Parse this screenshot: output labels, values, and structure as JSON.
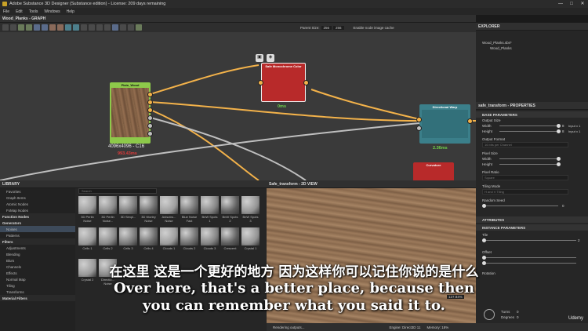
{
  "window": {
    "title": "Adobe Substance 3D Designer (Substance edition) - License: 209 days remaining",
    "min": "—",
    "max": "□",
    "close": "✕"
  },
  "menu": [
    "File",
    "Edit",
    "Tools",
    "Windows",
    "Help"
  ],
  "graph": {
    "title": "Wood_Planks - GRAPH",
    "parent_size_label": "Parent Size:",
    "parent_size_w": "256",
    "parent_size_h": "256",
    "cache_label": "Enable node image cache",
    "nodes": {
      "plain": {
        "title": "Plain_Wood",
        "size": "4096x4096 - C16",
        "time": "993.43ms"
      },
      "monochrome": {
        "title": "Safe Monochrome Color",
        "time": "0ms"
      },
      "directional": {
        "title": "Directional Warp",
        "time": "2.36ms"
      },
      "curvature": {
        "title": "Curvature"
      }
    }
  },
  "library": {
    "title": "LIBRARY",
    "search_placeholder": "Search",
    "tree": [
      {
        "label": "Favorites",
        "kind": "item"
      },
      {
        "label": "Graph Items",
        "kind": "item"
      },
      {
        "label": "Atomic Nodes",
        "kind": "item"
      },
      {
        "label": "FxMap Nodes",
        "kind": "item"
      },
      {
        "label": "Function Nodes",
        "kind": "cat"
      },
      {
        "label": "Generators",
        "kind": "cat"
      },
      {
        "label": "Noises",
        "kind": "sel"
      },
      {
        "label": "Patterns",
        "kind": "item"
      },
      {
        "label": "Filters",
        "kind": "cat"
      },
      {
        "label": "Adjustments",
        "kind": "item"
      },
      {
        "label": "Blending",
        "kind": "item"
      },
      {
        "label": "Blurs",
        "kind": "item"
      },
      {
        "label": "Channels",
        "kind": "item"
      },
      {
        "label": "Effects",
        "kind": "item"
      },
      {
        "label": "Normal Map",
        "kind": "item"
      },
      {
        "label": "Tiling",
        "kind": "item"
      },
      {
        "label": "Transforms",
        "kind": "item"
      },
      {
        "label": "Material Filters",
        "kind": "cat"
      }
    ],
    "thumbs_row1": [
      "3D Perlin Noise",
      "3D Perlin Noise...",
      "3D Simpl...",
      "3D Worley Noise",
      "Anisotro... Noise",
      "Blue Noise Fast",
      "BnW Spots 1",
      "BnW Spots 2",
      "BnW Spots 3"
    ],
    "thumbs_row2": [
      "Cells 1",
      "Cells 2",
      "Cells 3",
      "Cells 4",
      "Clouds 1",
      "Clouds 2",
      "Clouds 3",
      "Crescent",
      "Crystal 1"
    ],
    "thumbs_row3": [
      "Crystal 2",
      "Directio... Noise"
    ]
  },
  "view2d": {
    "title": "Safe_transform - 2D VIEW",
    "zoom": "127.84%"
  },
  "status": {
    "left": "Rendering outputs...",
    "engine": "Engine: Direct3D 11",
    "memory": "Memory: 18%"
  },
  "explorer": {
    "title": "EXPLORER",
    "file": "Wood_Planks.sbs*",
    "graph": "Wood_Planks"
  },
  "properties": {
    "title": "safe_transform - PROPERTIES",
    "base": "BASE PARAMETERS",
    "output_size": "Output Size",
    "width": "Width",
    "height": "Height",
    "width_val": "8",
    "height_val": "8",
    "input_x1": "Input x 1",
    "output_format": "Output Format",
    "format_val": "16 bits per Channel",
    "pixel_size": "Pixel Size",
    "pixel_ratio": "Pixel Ratio",
    "ratio_val": "Square",
    "tiling_mode": "Tiling Mode",
    "tiling_val": "H and V Tiling",
    "random_seed": "Random Seed",
    "seed_val": "0",
    "attributes": "ATTRIBUTES",
    "instance": "INSTANCE PARAMETERS",
    "tile": "Tile",
    "tile_val": "2",
    "offset": "Offset",
    "rotation": "Rotation",
    "turns": "Turns",
    "degrees": "Degrees",
    "turns_val": "0",
    "degrees_val": "0"
  },
  "subtitle": {
    "cn": "在这里 这是一个更好的地方 因为这样你可以记住你说的是什么",
    "en1": "Over here, that's a better place, because then",
    "en2": "you can remember what you said it to."
  },
  "watermark": "Udemy"
}
